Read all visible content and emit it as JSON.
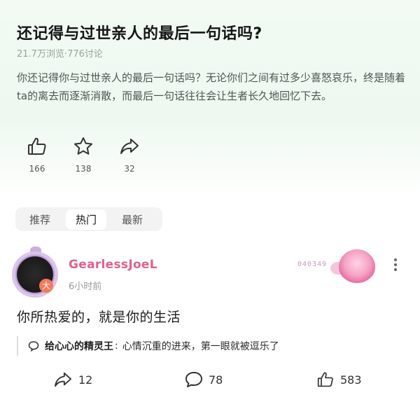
{
  "question": {
    "title": "还记得与过世亲人的最后一句话吗?",
    "meta": "21.7万浏览·776讨论",
    "description": "你还记得你与过世亲人的最后一句话吗？无论你们之间有过多少喜怒哀乐，终是随着ta的离去而逐渐消散，而最后一句话往往会让生者长久地回忆下去。",
    "actions": [
      {
        "icon": "thumb-up-icon",
        "count": "166"
      },
      {
        "icon": "star-icon",
        "count": "138"
      },
      {
        "icon": "share-icon",
        "count": "32"
      }
    ]
  },
  "tabs": [
    {
      "label": "推荐",
      "active": false
    },
    {
      "label": "热门",
      "active": true
    },
    {
      "label": "最新",
      "active": false
    }
  ],
  "comment": {
    "username": "GearlessJoeL",
    "avatar_badge": "大",
    "time": "6小时前",
    "decoration_text": "040349",
    "content": "你所热爱的，就是你的生活",
    "reply": {
      "author": "给心心的精灵王",
      "colon": ":",
      "text": "心情沉重的进来，第一眼就被逗乐了"
    },
    "footer": {
      "share": "12",
      "comment": "78",
      "like": "583"
    }
  },
  "colors": {
    "username": "#e0608f",
    "header_bg": "#eef8f0"
  }
}
